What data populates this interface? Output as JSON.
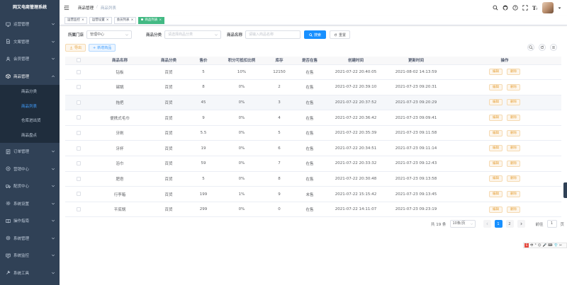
{
  "app_title": "网又电商管理系统",
  "sidebar": {
    "items": [
      {
        "label": "运营管理",
        "icon": "monitor-icon"
      },
      {
        "label": "文案管理",
        "icon": "document-icon"
      },
      {
        "label": "会员管理",
        "icon": "user-icon"
      },
      {
        "label": "商品管理",
        "icon": "goods-icon",
        "open": true
      },
      {
        "label": "订单管理",
        "icon": "order-icon"
      },
      {
        "label": "营销中心",
        "icon": "marketing-icon"
      },
      {
        "label": "配货中心",
        "icon": "truck-icon"
      },
      {
        "label": "系统设置",
        "icon": "settings-icon"
      },
      {
        "label": "操作指南",
        "icon": "guide-icon"
      },
      {
        "label": "系统管理",
        "icon": "system-icon"
      },
      {
        "label": "系统监控",
        "icon": "monitor2-icon"
      },
      {
        "label": "系统工具",
        "icon": "tool-icon"
      }
    ],
    "submenu": [
      "商品分类",
      "商品列表",
      "仓库进出货",
      "商品盘点"
    ],
    "submenu_active_index": 1
  },
  "breadcrumb": [
    "商品管理",
    "商品列表"
  ],
  "tags": [
    {
      "label": "运营监控",
      "active": false
    },
    {
      "label": "运营设置",
      "active": false
    },
    {
      "label": "会员列表",
      "active": false
    },
    {
      "label": "商品列表",
      "active": true
    }
  ],
  "filters": {
    "store_label": "所属门店",
    "store_value": "管理中心",
    "category_label": "商品分类",
    "category_placeholder": "请选择商品分类",
    "name_label": "商品名称",
    "name_placeholder": "请输入商品名称",
    "search_btn": "搜索",
    "reset_btn": "重置"
  },
  "toolbar": {
    "export_btn": "导出",
    "add_btn": "新增商品"
  },
  "table": {
    "headers": [
      "商品名称",
      "商品分类",
      "售价",
      "积分可抵扣比例",
      "库存",
      "是否在售",
      "创建时间",
      "更新时间",
      "操作"
    ],
    "edit_label": "编辑",
    "delete_label": "删除",
    "rows": [
      [
        "钻板",
        "百货",
        "5",
        "10%",
        "12150",
        "在售",
        "2021-07-22 20:40:05",
        "2021-08-02 14:13:59"
      ],
      [
        "锡锅",
        "百货",
        "8",
        "0%",
        "2",
        "在售",
        "2021-07-22 20:39:10",
        "2021-07-23 09:20:31"
      ],
      [
        "拖把",
        "百货",
        "45",
        "0%",
        "3",
        "在售",
        "2021-07-22 20:37:52",
        "2021-07-23 09:20:29"
      ],
      [
        "便携式毛巾",
        "百货",
        "9",
        "0%",
        "4",
        "在售",
        "2021-07-22 20:36:42",
        "2021-07-23 09:09:41"
      ],
      [
        "牙刷",
        "百货",
        "5.5",
        "0%",
        "5",
        "在售",
        "2021-07-22 20:35:39",
        "2021-07-23 09:11:58"
      ],
      [
        "牙杯",
        "百货",
        "19",
        "0%",
        "6",
        "在售",
        "2021-07-22 20:34:51",
        "2021-07-23 09:11:14"
      ],
      [
        "浴巾",
        "百货",
        "59",
        "0%",
        "7",
        "在售",
        "2021-07-22 20:33:32",
        "2021-07-23 09:12:43"
      ],
      [
        "肥皂",
        "百货",
        "5",
        "0%",
        "8",
        "在售",
        "2021-07-22 20:30:48",
        "2021-07-23 09:13:58"
      ],
      [
        "行李箱",
        "百货",
        "199",
        "1%",
        "9",
        "未售",
        "2021-07-22 15:15:42",
        "2021-07-23 09:13:45"
      ],
      [
        "平底锅",
        "百货",
        "299",
        "0%",
        "0",
        "在售",
        "2021-07-22 14:11:07",
        "2021-07-23 09:23:19"
      ]
    ]
  },
  "pagination": {
    "total_text": "共 19 条",
    "page_size": "10条/页",
    "pages": [
      "1",
      "2"
    ],
    "current": "1",
    "goto_label": "前往",
    "goto_value": "1",
    "page_suffix": "页"
  },
  "ime": {
    "logo": "S",
    "items": [
      "中",
      "°",
      "☺",
      "🎤",
      "⌨",
      "👕",
      "✂"
    ]
  }
}
